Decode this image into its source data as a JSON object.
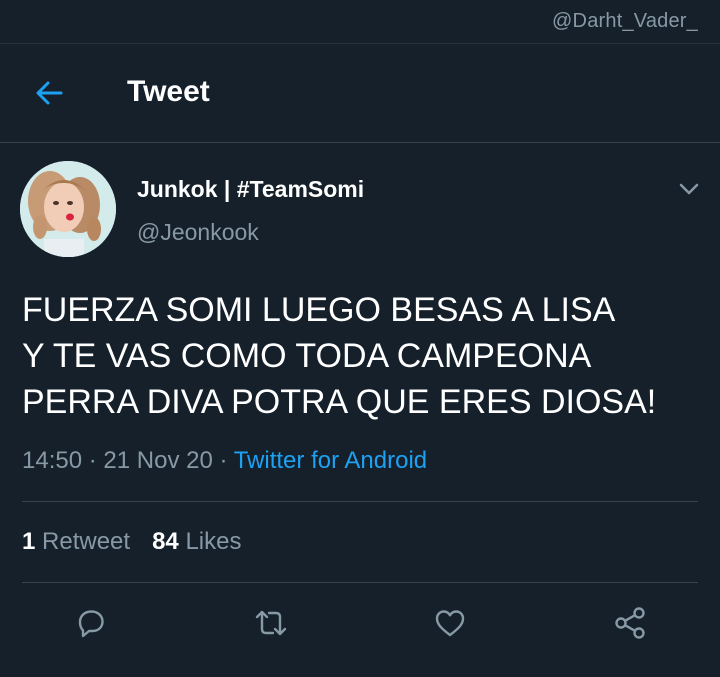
{
  "watermark": "@Darht_Vader_",
  "header": {
    "title": "Tweet",
    "back_icon": "arrow-left-icon"
  },
  "author": {
    "display_name": "Junkok | #TeamSomi",
    "handle": "@Jeonkook"
  },
  "tweet": {
    "text": "FUERZA SOMI LUEGO BESAS A LISA\nY TE VAS COMO TODA CAMPEONA\nPERRA DIVA POTRA QUE ERES DIOSA!",
    "time": "14:50",
    "date": "21 Nov 20",
    "separator": "·",
    "source": "Twitter for Android"
  },
  "stats": {
    "retweets_count": "1",
    "retweets_label": "Retweet",
    "likes_count": "84",
    "likes_label": "Likes"
  },
  "actions": [
    "reply-icon",
    "retweet-icon",
    "like-icon",
    "share-icon"
  ],
  "colors": {
    "background": "#15202b",
    "accent": "#1da1f2",
    "secondary_text": "#8899a6",
    "divider": "#38444d"
  }
}
